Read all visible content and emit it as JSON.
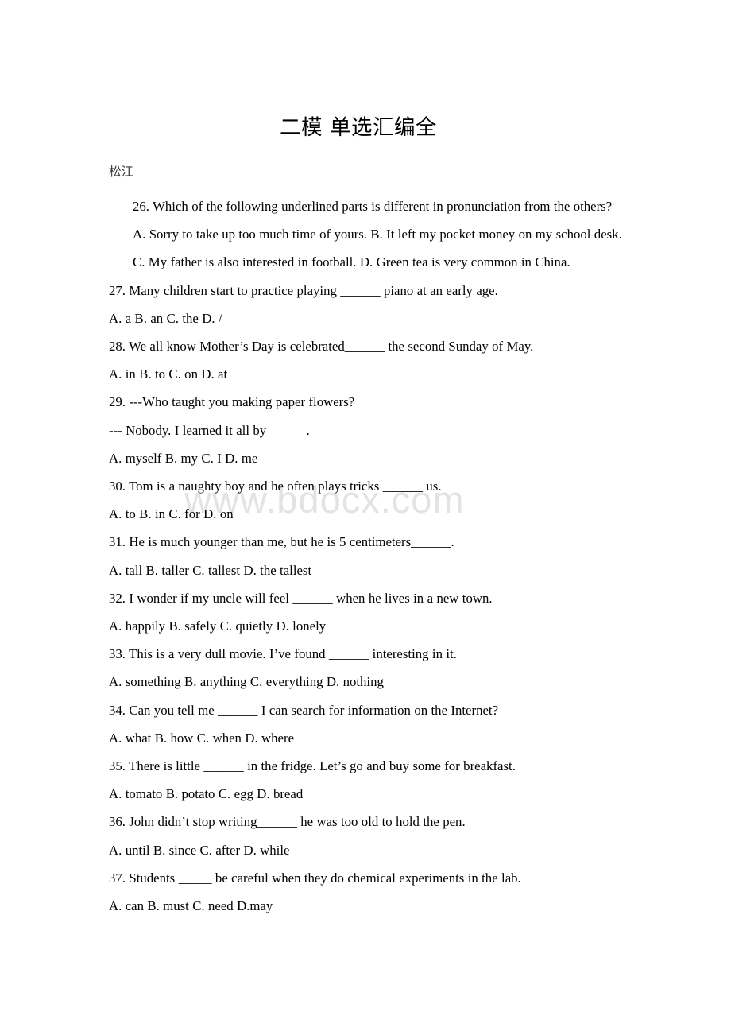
{
  "document": {
    "title": "二模 单选汇编全",
    "subtitle": "松江",
    "watermark": "www.bdocx.com",
    "watermark_color": "#e3e3e3",
    "text_color": "#000000",
    "background_color": "#ffffff"
  },
  "questions": [
    {
      "number": "26",
      "stem": "26. Which of the following underlined parts is different in pronunciation from the others?",
      "option_lines": [
        "A. Sorry to take up too much time of yours.  B. It left my pocket money on my school desk.",
        "C. My father is also interested in football. D. Green tea is very common in China."
      ]
    },
    {
      "number": "27",
      "stem": "27. Many children start to practice playing ______ piano at an early age.",
      "option_lines": [
        "A. a   B. an   C. the    D. /"
      ]
    },
    {
      "number": "28",
      "stem": "28. We all know Mother’s Day is celebrated______ the second Sunday of May.",
      "option_lines": [
        " A. in  B. to    C. on    D. at"
      ]
    },
    {
      "number": "29",
      "stem": "29. ---Who taught you making paper flowers?",
      "stem_line2": " --- Nobody. I learned it all by______.",
      "option_lines": [
        "A. myself  B. my   C. I    D. me"
      ]
    },
    {
      "number": "30",
      "stem": "30. Tom is a naughty boy and he often plays tricks ______ us.",
      "option_lines": [
        " A. to   B. in   C. for   D. on"
      ]
    },
    {
      "number": "31",
      "stem": "31. He is much younger than me, but he is 5 centimeters______.",
      "option_lines": [
        " A. tall   B. taller   C. tallest   D. the tallest"
      ]
    },
    {
      "number": "32",
      "stem": "32. I wonder if my uncle will feel ______ when he lives in a new town.",
      "option_lines": [
        " A. happily  B. safely   C. quietly   D. lonely"
      ]
    },
    {
      "number": "33",
      "stem": "33. This is a very dull movie. I’ve found ______ interesting in it.",
      "option_lines": [
        " A. something B. anything   C. everything   D. nothing"
      ]
    },
    {
      "number": "34",
      "stem": "34. Can you tell me ______ I can search for information on the Internet?",
      "option_lines": [
        " A. what  B. how    C. when    D. where"
      ]
    },
    {
      "number": "35",
      "stem": "35. There is little ______ in the fridge. Let’s go and buy some for breakfast.",
      "option_lines": [
        " A. tomato  B. potato    C. egg    D. bread"
      ]
    },
    {
      "number": "36",
      "stem": "36. John didn’t stop writing______ he was too old to hold the pen.",
      "option_lines": [
        "A. until    B. since    C. after    D. while"
      ]
    },
    {
      "number": "37",
      "stem": "37. Students _____ be careful when they do chemical experiments in the lab.",
      "option_lines": [
        "A. can    B. must    C. need    D.may"
      ]
    }
  ]
}
